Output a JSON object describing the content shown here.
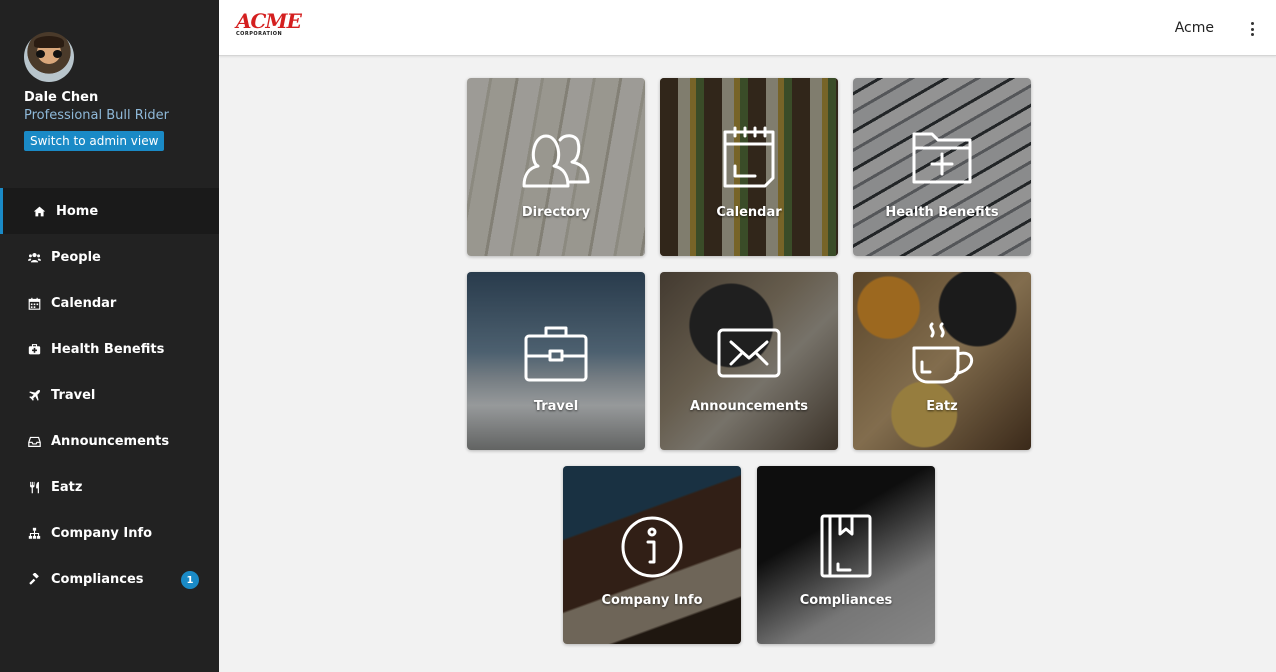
{
  "profile": {
    "name": "Dale Chen",
    "title": "Professional Bull Rider",
    "admin_button": "Switch to admin view"
  },
  "nav": [
    {
      "label": "Home",
      "icon": "home-icon",
      "active": true
    },
    {
      "label": "People",
      "icon": "people-icon"
    },
    {
      "label": "Calendar",
      "icon": "calendar-icon"
    },
    {
      "label": "Health Benefits",
      "icon": "medkit-icon"
    },
    {
      "label": "Travel",
      "icon": "plane-icon"
    },
    {
      "label": "Announcements",
      "icon": "inbox-icon"
    },
    {
      "label": "Eatz",
      "icon": "utensils-icon"
    },
    {
      "label": "Company Info",
      "icon": "sitemap-icon"
    },
    {
      "label": "Compliances",
      "icon": "gavel-icon",
      "badge": "1"
    }
  ],
  "header": {
    "logo_text": "ACME",
    "logo_subtext": "CORPORATION",
    "company": "Acme"
  },
  "tiles": [
    {
      "label": "Directory",
      "icon": "people-outline-icon"
    },
    {
      "label": "Calendar",
      "icon": "calendar-outline-icon"
    },
    {
      "label": "Health Benefits",
      "icon": "folder-plus-icon"
    },
    {
      "label": "Travel",
      "icon": "briefcase-icon"
    },
    {
      "label": "Announcements",
      "icon": "envelope-icon"
    },
    {
      "label": "Eatz",
      "icon": "coffee-cup-icon"
    },
    {
      "label": "Company Info",
      "icon": "info-circle-icon"
    },
    {
      "label": "Compliances",
      "icon": "bookmark-book-icon"
    }
  ],
  "colors": {
    "sidebar_bg": "#222222",
    "accent": "#1a8ac6",
    "logo_red": "#d41f1f",
    "page_bg": "#f2f2f2"
  }
}
